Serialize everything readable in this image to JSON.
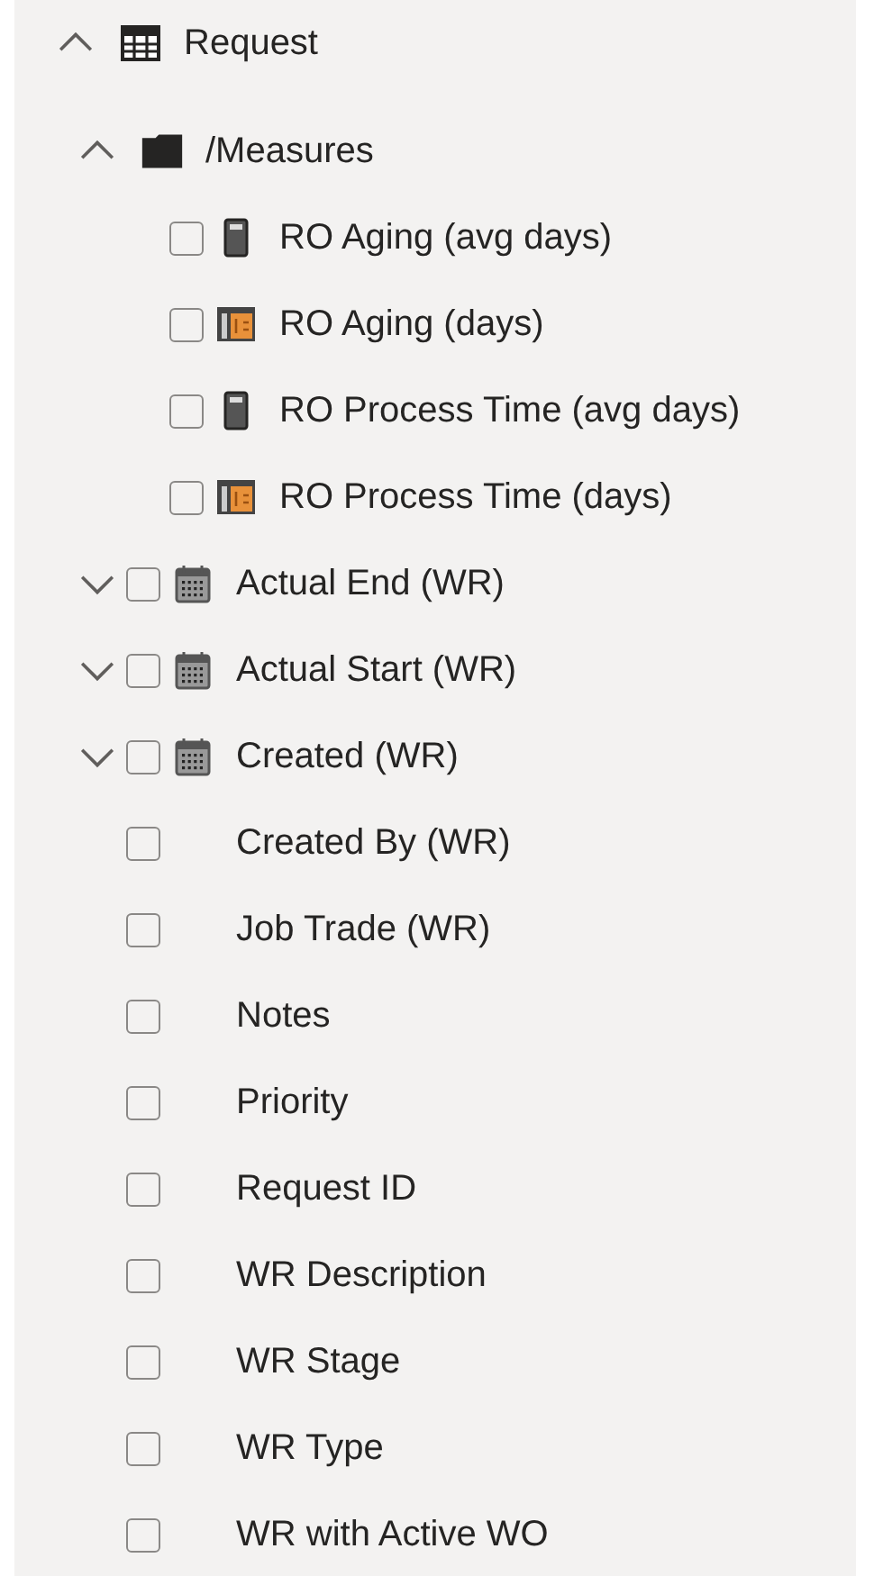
{
  "tree": [
    {
      "label": "Request",
      "kind": "table",
      "expanded": true,
      "children": [
        {
          "label": "/Measures",
          "kind": "folder",
          "expanded": true,
          "children": [
            {
              "label": "RO Aging (avg days)",
              "kind": "measure",
              "checked": false
            },
            {
              "label": "RO Aging (days)",
              "kind": "calc",
              "checked": false
            },
            {
              "label": "RO Process Time (avg days)",
              "kind": "measure",
              "checked": false
            },
            {
              "label": "RO Process Time (days)",
              "kind": "calc",
              "checked": false
            }
          ]
        },
        {
          "label": "Actual End (WR)",
          "kind": "date",
          "expanded": false,
          "checked": false
        },
        {
          "label": "Actual Start (WR)",
          "kind": "date",
          "expanded": false,
          "checked": false
        },
        {
          "label": "Created (WR)",
          "kind": "date",
          "expanded": false,
          "checked": false
        },
        {
          "label": "Created By (WR)",
          "kind": "field",
          "checked": false
        },
        {
          "label": "Job Trade (WR)",
          "kind": "field",
          "checked": false
        },
        {
          "label": "Notes",
          "kind": "field",
          "checked": false
        },
        {
          "label": "Priority",
          "kind": "field",
          "checked": false
        },
        {
          "label": "Request ID",
          "kind": "field",
          "checked": false
        },
        {
          "label": "WR Description",
          "kind": "field",
          "checked": false
        },
        {
          "label": "WR Stage",
          "kind": "field",
          "checked": false
        },
        {
          "label": "WR Type",
          "kind": "field",
          "checked": false
        },
        {
          "label": "WR with Active WO",
          "kind": "field",
          "checked": false
        }
      ]
    }
  ]
}
